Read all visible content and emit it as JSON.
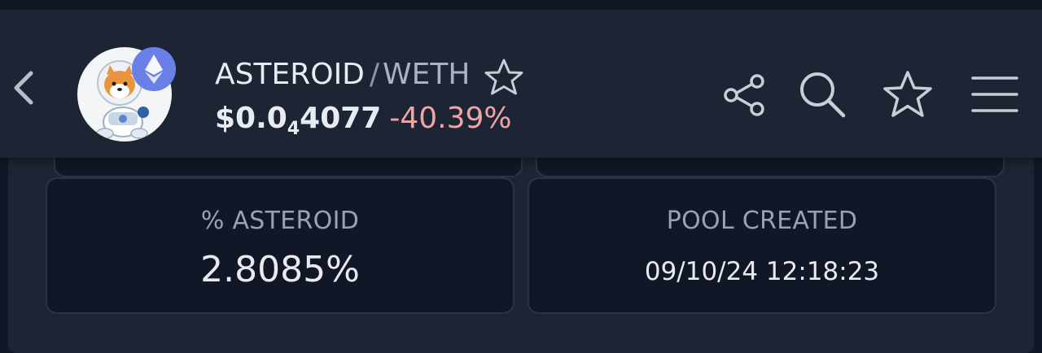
{
  "header": {
    "base_symbol": "ASTEROID",
    "separator": "/",
    "quote_symbol": "WETH",
    "price_main": "$0.0",
    "price_subscript": "4",
    "price_tail": "4077",
    "price_change": "-40.39%",
    "icons": {
      "back": "chevron-left-icon",
      "chain_badge": "ethereum-icon",
      "title_star": "star-outline-icon",
      "share": "share-icon",
      "search": "search-icon",
      "watchlist": "star-outline-icon",
      "menu": "hamburger-menu-icon"
    }
  },
  "stats": {
    "left": {
      "label": "% ASTEROID",
      "value": "2.8085%"
    },
    "right": {
      "label": "POOL CREATED",
      "value": "09/10/24 12:18:23"
    }
  },
  "colors": {
    "page_background": "#111725",
    "panel_background": "#1d2433",
    "card_background": "#111726",
    "negative_change": "#f0a5a5",
    "ethereum_badge": "#6a7fe8"
  }
}
